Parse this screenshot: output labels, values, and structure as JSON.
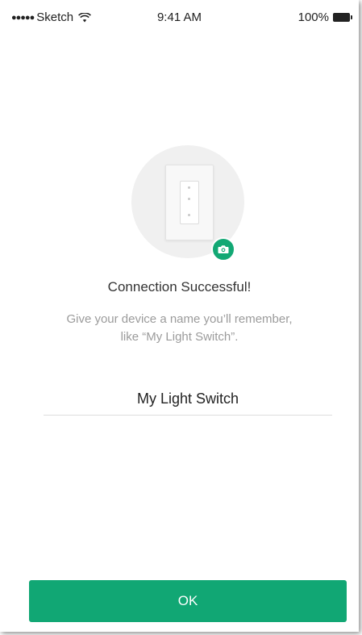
{
  "status_bar": {
    "signal": "●●●●●",
    "carrier": "Sketch",
    "wifi_icon": "wifi-icon",
    "time": "9:41 AM",
    "battery_percent": "100%",
    "battery_icon": "battery-icon"
  },
  "device": {
    "illustration": "light-switch-icon",
    "camera_icon": "camera-icon",
    "accent_color": "#12a874"
  },
  "content": {
    "title": "Connection Successful!",
    "subtitle_line1": "Give your device a name you’ll remember,",
    "subtitle_line2": "like “My Light Switch”.",
    "name_value": "My Light Switch"
  },
  "actions": {
    "ok_label": "OK",
    "ok_color": "#11a774"
  }
}
